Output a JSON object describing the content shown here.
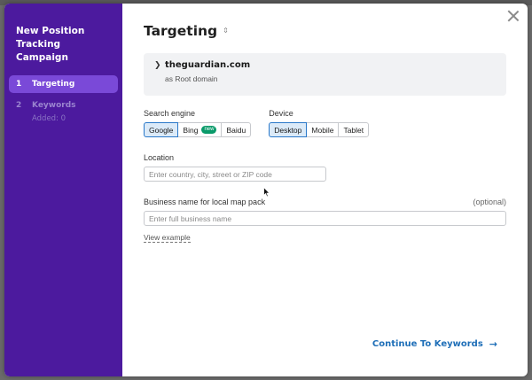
{
  "sidebar": {
    "title": "New Position Tracking Campaign",
    "steps": [
      {
        "num": "1",
        "label": "Targeting",
        "sub": ""
      },
      {
        "num": "2",
        "label": "Keywords",
        "sub": "Added: 0"
      }
    ]
  },
  "main": {
    "title": "Targeting",
    "domain": {
      "name": "theguardian.com",
      "type": "as Root domain"
    },
    "search_engine": {
      "label": "Search engine",
      "options": [
        "Google",
        "Bing",
        "Baidu"
      ],
      "selected": "Google",
      "bing_badge": "new"
    },
    "device": {
      "label": "Device",
      "options": [
        "Desktop",
        "Mobile",
        "Tablet"
      ],
      "selected": "Desktop"
    },
    "location": {
      "label": "Location",
      "placeholder": "Enter country, city, street or ZIP code"
    },
    "business": {
      "label": "Business name for local map pack",
      "optional": "(optional)",
      "placeholder": "Enter full business name"
    },
    "view_example": "View example",
    "continue_label": "Continue To Keywords"
  },
  "icons": {
    "close": "close-icon",
    "sort": "sort-icon",
    "chevron": "chevron-right-icon",
    "arrow": "arrow-right-icon",
    "cursor": "mouse-cursor-icon"
  },
  "colors": {
    "sidebar_bg": "#4c1a9e",
    "active_step": "#7a49d8",
    "accent": "#1f6fb8",
    "new_badge": "#0a9a6a"
  }
}
